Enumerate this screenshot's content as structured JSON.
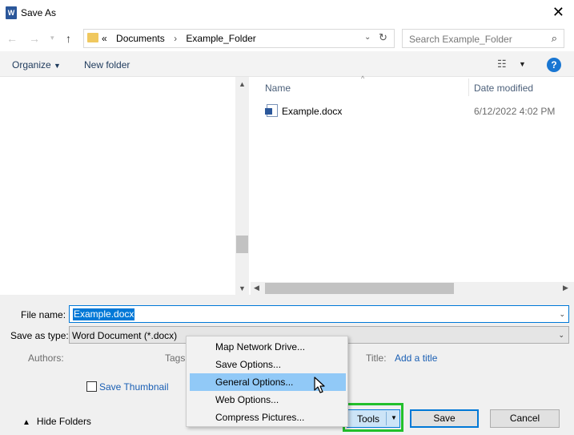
{
  "window": {
    "title": "Save As",
    "app_icon": "word-icon",
    "close_glyph": "✕"
  },
  "address": {
    "prefix": "«",
    "crumbs": [
      "Documents",
      "Example_Folder"
    ],
    "separator": "›"
  },
  "search": {
    "placeholder": "Search Example_Folder"
  },
  "toolbar": {
    "organize": "Organize",
    "new_folder": "New folder",
    "help": "?"
  },
  "columns": {
    "name": "Name",
    "date": "Date modified"
  },
  "files": [
    {
      "name": "Example.docx",
      "date": "6/12/2022 4:02 PM"
    }
  ],
  "form": {
    "file_name_label": "File name:",
    "file_name_value": "Example.docx",
    "save_type_label": "Save as type:",
    "save_type_value": "Word Document (*.docx)",
    "authors_label": "Authors:",
    "tags_label": "Tags:",
    "title_label": "Title:",
    "title_link": "Add a title",
    "thumbnail_label": "Save Thumbnail"
  },
  "buttons": {
    "hide_folders": "Hide Folders",
    "tools": "Tools",
    "save": "Save",
    "cancel": "Cancel"
  },
  "tools_menu": {
    "items": [
      "Map Network Drive...",
      "Save Options...",
      "General Options...",
      "Web Options...",
      "Compress Pictures..."
    ],
    "highlighted": "General Options..."
  },
  "colors": {
    "accent": "#0078d7",
    "highlight_box": "#22c02c",
    "menu_hover": "#91c9f7"
  }
}
